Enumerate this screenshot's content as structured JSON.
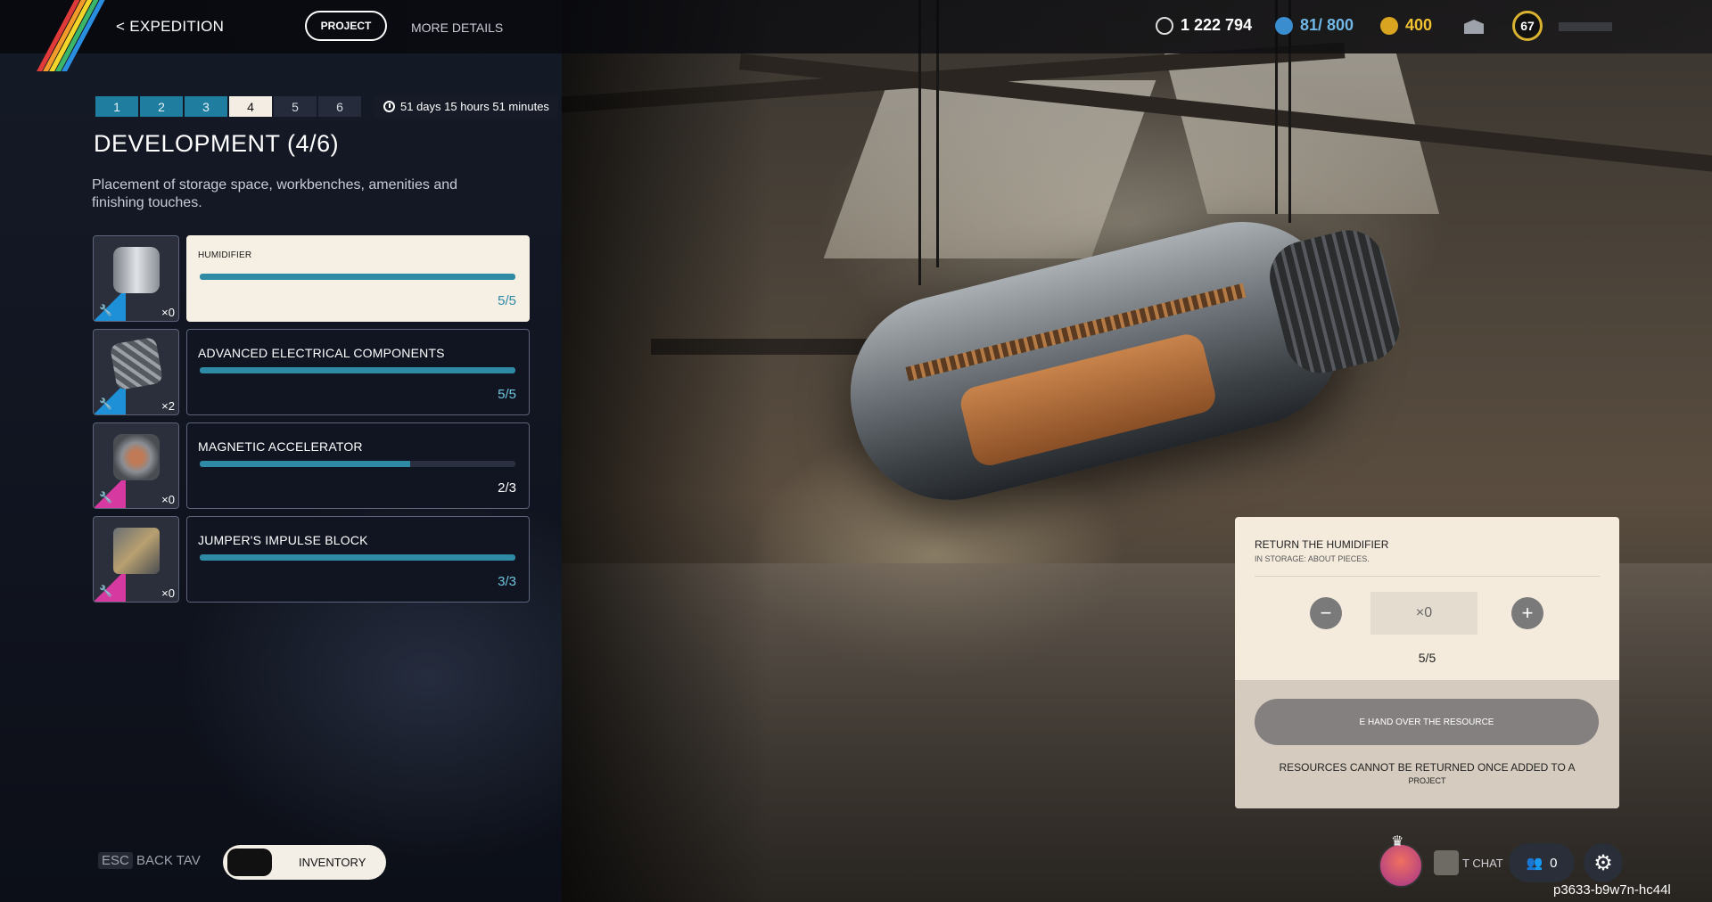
{
  "header": {
    "back_label": "< EXPEDITION",
    "tabs": [
      {
        "label": "PROJECT"
      },
      {
        "label": "MORE DETAILS"
      }
    ],
    "currency_1": "1 222 794",
    "currency_2": "81/ 800",
    "currency_3": "400",
    "level": "67"
  },
  "steps": [
    "1",
    "2",
    "3",
    "4",
    "5",
    "6"
  ],
  "timer": "51 days 15 hours 51 minutes",
  "title": "DEVELOPMENT (4/6)",
  "description": "Placement of storage space, workbenches, amenities and finishing touches.",
  "items": [
    {
      "name": "HUMIDIFIER",
      "qty": "×0",
      "count": "5/5",
      "progress": 1.0
    },
    {
      "name": "ADVANCED ELECTRICAL COMPONENTS",
      "qty": "×2",
      "count": "5/5",
      "progress": 1.0
    },
    {
      "name": "MAGNETIC ACCELERATOR",
      "qty": "×0",
      "count": "2/3",
      "progress": 0.667
    },
    {
      "name": "JUMPER'S IMPULSE BLOCK",
      "qty": "×0",
      "count": "3/3",
      "progress": 1.0
    }
  ],
  "footer": {
    "esc_key": "ESC",
    "back_label": "BACK TAV",
    "inventory_label": "INVENTORY"
  },
  "panel": {
    "title": "RETURN THE HUMIDIFIER",
    "subtitle": "IN STORAGE: ABOUT PIECES.",
    "minus": "−",
    "plus": "+",
    "quantity": "×0",
    "fraction": "5/5",
    "hand_over": "E HAND OVER THE RESOURCE",
    "warning": "RESOURCES CANNOT BE RETURNED ONCE ADDED TO A",
    "warning_2": "PROJECT"
  },
  "social": {
    "chat_label": "T CHAT",
    "friends_count": "0",
    "session_code": "p3633-b9w7n-hc44l"
  },
  "colors": {
    "accent": "#2f8aa6",
    "step_done": "#1f7da0",
    "panel_bg": "#f4ebdd",
    "gold": "#d9b230"
  }
}
